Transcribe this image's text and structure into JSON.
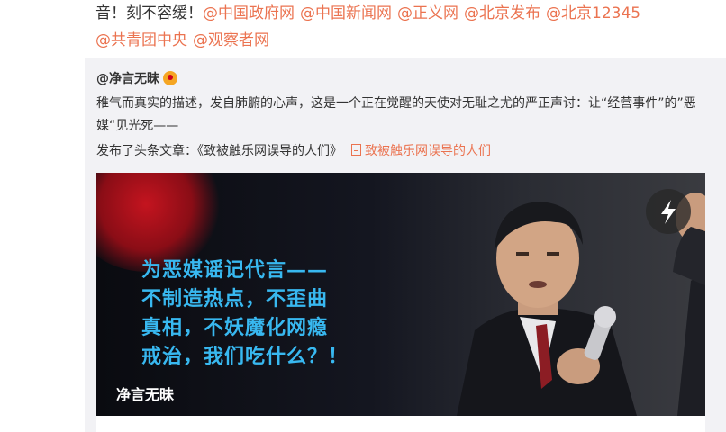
{
  "post": {
    "text_prefix": "音！刻不容缓！",
    "mentions": [
      "@中国政府网",
      "@中国新闻网",
      "@正义网",
      "@北京发布",
      "@北京12345",
      "@共青团中央",
      "@观察者网"
    ]
  },
  "retweet": {
    "author": "@净言无昧",
    "body": "稚气而真实的描述，发自肺腑的心声，这是一个正在觉醒的天使对无耻之尤的严正声讨：让“经营事件”的”恶媒“见光死——",
    "published_prefix": "发布了头条文章：《致被触乐网误导的人们》",
    "article_link": "致被触乐网误导的人们"
  },
  "card": {
    "image_caption": "为恶媒谣记代言——不制造热点，不歪曲真相，不妖魔化网瘾戒治，我们吃什么？！",
    "caption_lines": [
      "为恶媒谣记代言——",
      "不制造热点，不歪曲",
      "真相，不妖魔化网瘾",
      "戒治，我们吃什么？！"
    ],
    "title": "净言无昧",
    "play_icon": "lightning-icon"
  },
  "colors": {
    "link": "#eb7350",
    "caption": "#38b8f0",
    "retweet_bg": "#f2f2f5"
  }
}
